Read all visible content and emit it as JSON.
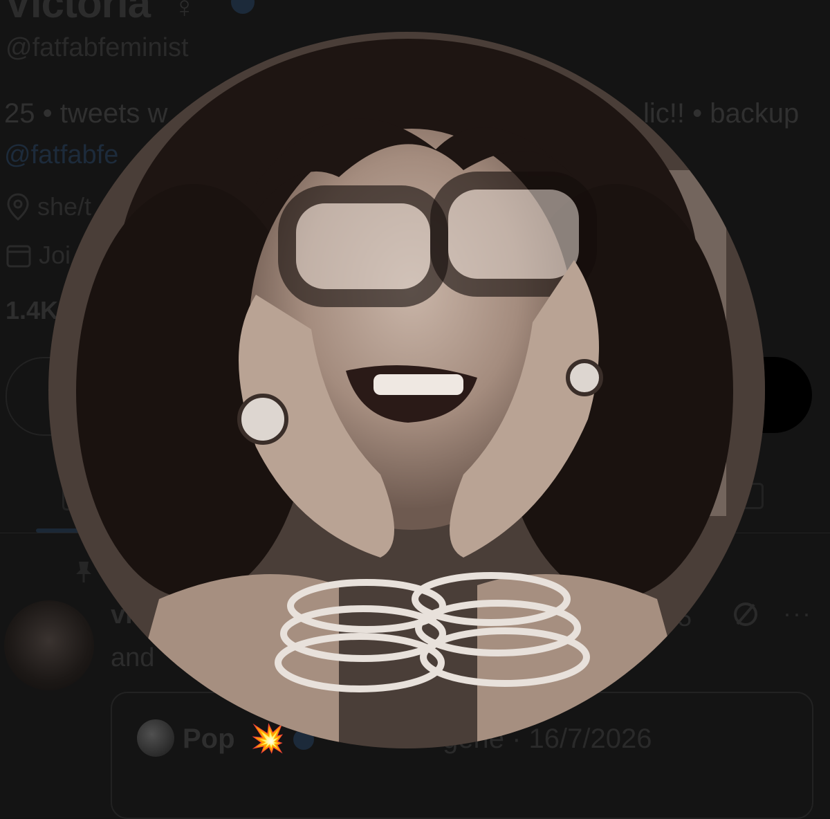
{
  "profile": {
    "name": "Victoria",
    "name_symbol": "♀",
    "handle": "@fatfabfeminist",
    "bio_left": "25 • tweets w",
    "bio_right": "lic!! • backup",
    "bio_link": "@fatfabfe",
    "location": "she/t",
    "joined": "Joi",
    "stats": "1.4K"
  },
  "tweet": {
    "author": "vi",
    "text": "and",
    "meta_right": "5"
  },
  "quoted": {
    "name": "Pop",
    "emoji": "💥",
    "meta": "gene · 16/7/2026"
  },
  "photo": {
    "icon": "profile-photo"
  }
}
